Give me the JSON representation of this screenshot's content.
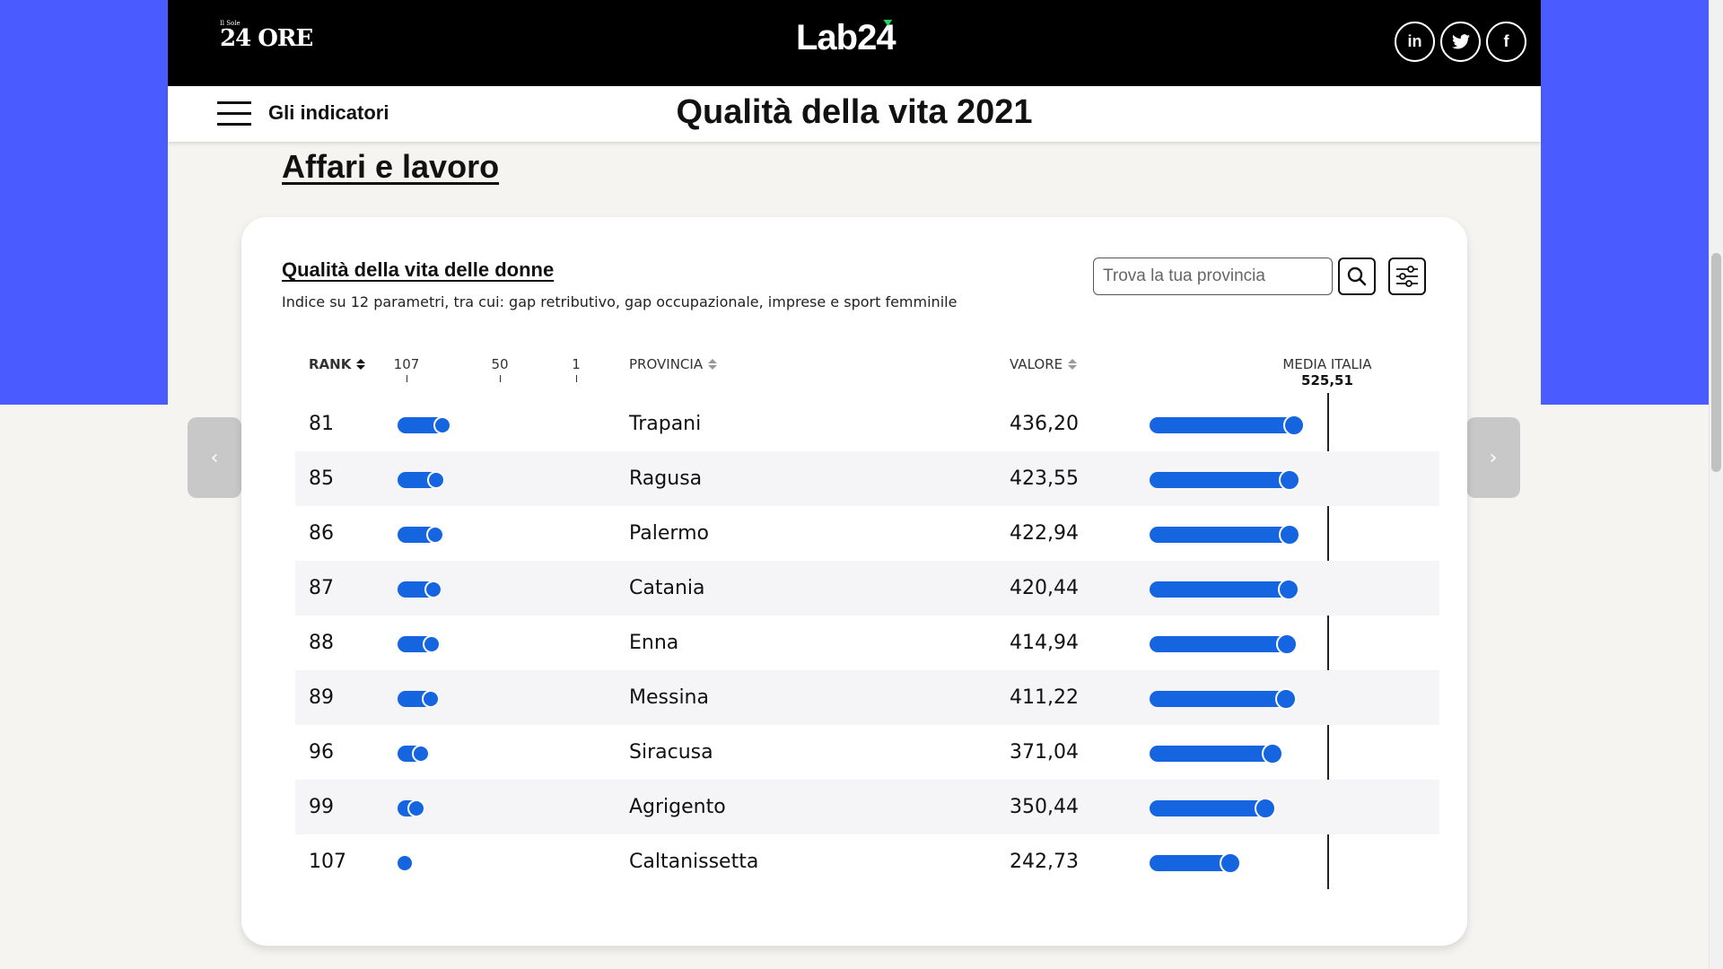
{
  "header": {
    "sole_logo_small": "Il Sole",
    "sole_logo": "24 ORE",
    "lab_logo_a": "Lab2",
    "lab_logo_b": "4",
    "social": [
      {
        "icon": "linkedin-icon",
        "glyph": "in"
      },
      {
        "icon": "twitter-icon",
        "glyph": "🐦"
      },
      {
        "icon": "facebook-icon",
        "glyph": "f"
      }
    ]
  },
  "subbar": {
    "menu_label": "Gli indicatori",
    "title": "Qualità della vita 2021"
  },
  "section": {
    "title": "Affari e lavoro"
  },
  "nav": {
    "prev": "‹",
    "next": "›"
  },
  "card": {
    "title": "Qualità della vita delle donne",
    "subtitle": "Indice su 12 parametri, tra cui: gap retributivo, gap occupazionale, imprese e sport femminile",
    "search_placeholder": "Trova la tua provincia"
  },
  "columns": {
    "rank": "RANK",
    "scale_ticks": [
      "107",
      "50",
      "1"
    ],
    "provincia": "PROVINCIA",
    "valore": "VALORE",
    "media_label": "MEDIA ITALIA",
    "media_value": "525,51"
  },
  "chart_data": {
    "type": "table",
    "rank_range": [
      107,
      1
    ],
    "media_italia": 525.51,
    "rows": [
      {
        "rank": 81,
        "provincia": "Trapani",
        "valore": "436,20",
        "value": 436.2
      },
      {
        "rank": 85,
        "provincia": "Ragusa",
        "valore": "423,55",
        "value": 423.55
      },
      {
        "rank": 86,
        "provincia": "Palermo",
        "valore": "422,94",
        "value": 422.94
      },
      {
        "rank": 87,
        "provincia": "Catania",
        "valore": "420,44",
        "value": 420.44
      },
      {
        "rank": 88,
        "provincia": "Enna",
        "valore": "414,94",
        "value": 414.94
      },
      {
        "rank": 89,
        "provincia": "Messina",
        "valore": "411,22",
        "value": 411.22
      },
      {
        "rank": 96,
        "provincia": "Siracusa",
        "valore": "371,04",
        "value": 371.04
      },
      {
        "rank": 99,
        "provincia": "Agrigento",
        "valore": "350,44",
        "value": 350.44
      },
      {
        "rank": 107,
        "provincia": "Caltanissetta",
        "valore": "242,73",
        "value": 242.73
      }
    ]
  },
  "colors": {
    "accent": "#1565e0",
    "bg_blue": "#4a5cff"
  }
}
